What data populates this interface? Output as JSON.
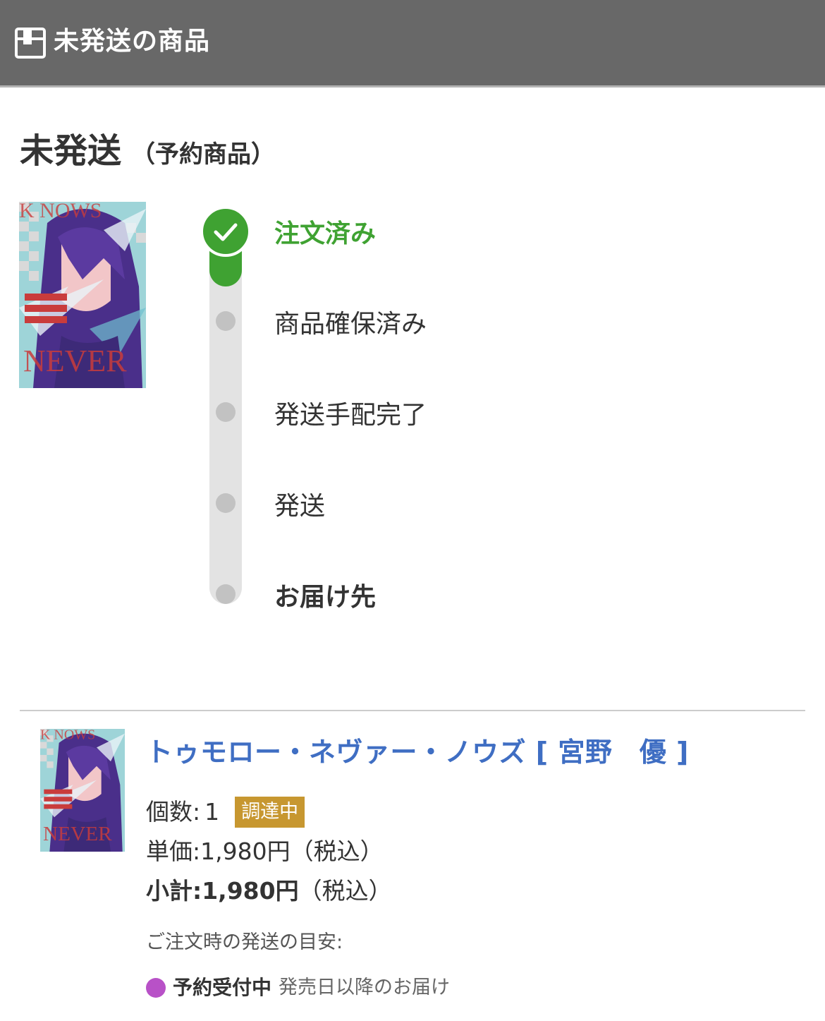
{
  "header": {
    "title": "未発送の商品",
    "icon": "package-box-icon"
  },
  "section": {
    "title": "未発送",
    "subtitle": "（予約商品）"
  },
  "progress": {
    "steps": [
      {
        "label": "注文済み",
        "state": "done"
      },
      {
        "label": "商品確保済み",
        "state": "pending"
      },
      {
        "label": "発送手配完了",
        "state": "pending"
      },
      {
        "label": "発送",
        "state": "pending"
      },
      {
        "label": "お届け先",
        "state": "pending"
      }
    ],
    "completed_fraction": 0.2
  },
  "product": {
    "title": "トゥモロー・ネヴァー・ノウズ [ 宮野　優 ]",
    "quantity_label": "個数:",
    "quantity": "1",
    "badge": "調達中",
    "unit_price_label": "単価:",
    "unit_price": "1,980円",
    "tax_note": "（税込）",
    "subtotal_label": "小計:",
    "subtotal": "1,980円",
    "subtotal_tax_note": "（税込）",
    "shipping_heading": "ご注文時の発送の目安:",
    "status_name": "予約受付中",
    "status_note": "発売日以降のお届け"
  },
  "colors": {
    "header_bg": "#686868",
    "done_green": "#3fa232",
    "link_blue": "#3f6ec3",
    "badge_gold": "#c79730",
    "status_purple": "#b851c7",
    "track_gray": "#e3e3e3",
    "dot_gray": "#c2c2c2"
  }
}
